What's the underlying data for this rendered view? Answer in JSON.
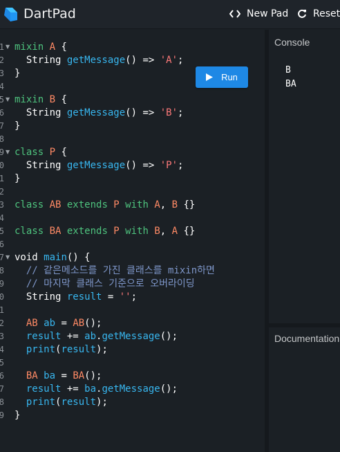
{
  "app": {
    "title": "DartPad",
    "new_pad_label": "New Pad",
    "reset_label": "Reset",
    "icons": {
      "logo": "dart-logo-icon",
      "new_pad": "code-brackets-icon",
      "reset": "refresh-icon",
      "run": "play-icon"
    }
  },
  "editor": {
    "run_label": "Run",
    "line_numbers": [
      "1",
      "2",
      "3",
      "4",
      "5",
      "6",
      "7",
      "8",
      "9",
      "0",
      "1",
      "2",
      "3",
      "4",
      "5",
      "6",
      "7",
      "8",
      "9",
      "0",
      "1",
      "2",
      "3",
      "4",
      "5",
      "6",
      "7",
      "8",
      "9"
    ],
    "lines": [
      [
        [
          "kw",
          "mixin "
        ],
        [
          "type",
          "A"
        ],
        [
          "punc",
          " {"
        ]
      ],
      [
        [
          "punc",
          "  String "
        ],
        [
          "fn",
          "getMessage"
        ],
        [
          "punc",
          "() => "
        ],
        [
          "str",
          "'A'"
        ],
        [
          "punc",
          ";"
        ]
      ],
      [
        [
          "punc",
          "}"
        ]
      ],
      [],
      [
        [
          "kw",
          "mixin "
        ],
        [
          "type",
          "B"
        ],
        [
          "punc",
          " {"
        ]
      ],
      [
        [
          "punc",
          "  String "
        ],
        [
          "fn",
          "getMessage"
        ],
        [
          "punc",
          "() => "
        ],
        [
          "str",
          "'B'"
        ],
        [
          "punc",
          ";"
        ]
      ],
      [
        [
          "punc",
          "}"
        ]
      ],
      [],
      [
        [
          "kw",
          "class "
        ],
        [
          "type",
          "P"
        ],
        [
          "punc",
          " {"
        ]
      ],
      [
        [
          "punc",
          "  String "
        ],
        [
          "fn",
          "getMessage"
        ],
        [
          "punc",
          "() => "
        ],
        [
          "str",
          "'P'"
        ],
        [
          "punc",
          ";"
        ]
      ],
      [
        [
          "punc",
          "}"
        ]
      ],
      [],
      [
        [
          "kw",
          "class "
        ],
        [
          "type",
          "AB"
        ],
        [
          "kw",
          " extends "
        ],
        [
          "type",
          "P"
        ],
        [
          "kw",
          " with "
        ],
        [
          "type",
          "A"
        ],
        [
          "punc",
          ", "
        ],
        [
          "type",
          "B"
        ],
        [
          "punc",
          " {}"
        ]
      ],
      [],
      [
        [
          "kw",
          "class "
        ],
        [
          "type",
          "BA"
        ],
        [
          "kw",
          " extends "
        ],
        [
          "type",
          "P"
        ],
        [
          "kw",
          " with "
        ],
        [
          "type",
          "B"
        ],
        [
          "punc",
          ", "
        ],
        [
          "type",
          "A"
        ],
        [
          "punc",
          " {}"
        ]
      ],
      [],
      [
        [
          "punc",
          "void "
        ],
        [
          "fn",
          "main"
        ],
        [
          "punc",
          "() {"
        ]
      ],
      [
        [
          "cm",
          "  // 같은메소드를 가진 클래스를 mixin하면"
        ]
      ],
      [
        [
          "cm",
          "  // 마지막 클래스 기준으로 오버라이딩"
        ]
      ],
      [
        [
          "punc",
          "  String "
        ],
        [
          "fn",
          "result"
        ],
        [
          "punc",
          " = "
        ],
        [
          "str",
          "''"
        ],
        [
          "punc",
          ";"
        ]
      ],
      [],
      [
        [
          "type",
          "  AB "
        ],
        [
          "fn",
          "ab"
        ],
        [
          "punc",
          " = "
        ],
        [
          "type",
          "AB"
        ],
        [
          "punc",
          "();"
        ]
      ],
      [
        [
          "fn",
          "  result"
        ],
        [
          "punc",
          " += "
        ],
        [
          "fn",
          "ab"
        ],
        [
          "punc",
          "."
        ],
        [
          "fn",
          "getMessage"
        ],
        [
          "punc",
          "();"
        ]
      ],
      [
        [
          "fn",
          "  print"
        ],
        [
          "punc",
          "("
        ],
        [
          "fn",
          "result"
        ],
        [
          "punc",
          ");"
        ]
      ],
      [],
      [
        [
          "type",
          "  BA "
        ],
        [
          "fn",
          "ba"
        ],
        [
          "punc",
          " = "
        ],
        [
          "type",
          "BA"
        ],
        [
          "punc",
          "();"
        ]
      ],
      [
        [
          "fn",
          "  result"
        ],
        [
          "punc",
          " += "
        ],
        [
          "fn",
          "ba"
        ],
        [
          "punc",
          "."
        ],
        [
          "fn",
          "getMessage"
        ],
        [
          "punc",
          "();"
        ]
      ],
      [
        [
          "fn",
          "  print"
        ],
        [
          "punc",
          "("
        ],
        [
          "fn",
          "result"
        ],
        [
          "punc",
          ");"
        ]
      ],
      [
        [
          "punc",
          "}"
        ]
      ]
    ],
    "fold_lines": [
      0,
      4,
      8,
      16
    ]
  },
  "console": {
    "title": "Console",
    "output": [
      "B",
      "BA"
    ]
  },
  "documentation": {
    "title": "Documentation"
  },
  "colors": {
    "keyword": "#4ec37e",
    "type": "#ff8a65",
    "function": "#38b7f0",
    "string": "#ff7a7a",
    "comment": "#7e96c9",
    "run_button": "#1e88e5"
  }
}
